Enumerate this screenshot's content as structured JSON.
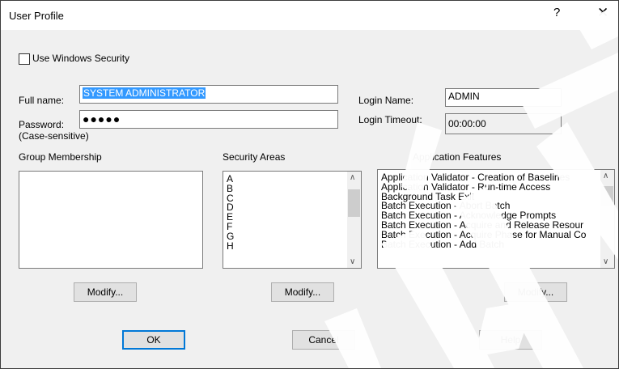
{
  "window": {
    "title": "User Profile",
    "help_glyph": "?",
    "close_glyph": "✕"
  },
  "options": {
    "use_windows_security_label": "Use Windows Security",
    "use_windows_security_checked": false
  },
  "account": {
    "full_name_label": "Full name:",
    "full_name_value": "SYSTEM ADMINISTRATOR",
    "password_label": "Password:",
    "password_note": "(Case-sensitive)",
    "password_value": "●●●●●",
    "login_name_label": "Login Name:",
    "login_name_value": "ADMIN",
    "login_timeout_label": "Login Timeout:",
    "login_timeout_value": "00:00:00"
  },
  "group_membership": {
    "label": "Group Membership",
    "modify_label": "Modify..."
  },
  "security_areas": {
    "label": "Security Areas",
    "items": [
      "A",
      "B",
      "C",
      "D",
      "E",
      "F",
      "G",
      "H"
    ],
    "modify_label": "Modify..."
  },
  "application_features": {
    "label": "Application Features",
    "items": [
      "Application Validator - Creation of Baselines",
      "Application Validator - Run-time Access",
      "Background Task Exit",
      "Batch Execution - Abort Batch",
      "Batch Execution - Acknowledge Prompts",
      "Batch Execution - Acquire and Release Resour",
      "Batch Execution - Acquire Phase for Manual Co",
      "Batch Execution - Add Batch"
    ],
    "modify_label": "Modify..."
  },
  "footer": {
    "ok_label": "OK",
    "cancel_label": "Cancel",
    "help_label": "Help"
  },
  "scrollbar_glyphs": {
    "up": "∧",
    "down": "∨"
  }
}
